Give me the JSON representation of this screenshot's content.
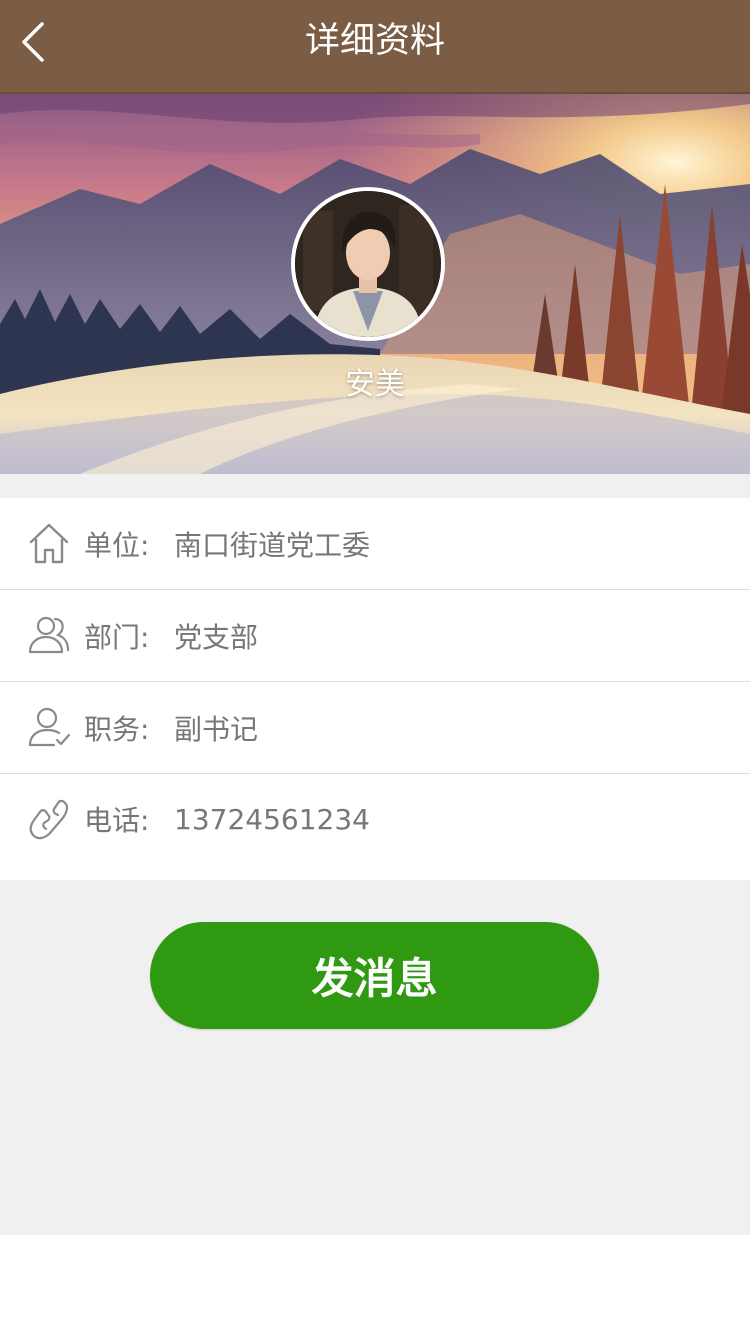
{
  "header": {
    "title": "详细资料",
    "back_icon": "chevron-left-icon"
  },
  "profile": {
    "name": "安美"
  },
  "info": {
    "unit": {
      "icon": "home-icon",
      "label": "单位:",
      "value": "南口街道党工委"
    },
    "department": {
      "icon": "users-icon",
      "label": "部门:",
      "value": "党支部"
    },
    "position": {
      "icon": "user-check-icon",
      "label": "职务:",
      "value": "副书记"
    },
    "phone": {
      "icon": "phone-icon",
      "label": "电话:",
      "value": "13724561234"
    }
  },
  "actions": {
    "send_message_label": "发消息"
  },
  "colors": {
    "header_bg": "#7b5c44",
    "button_bg": "#2f9912",
    "page_bg": "#f0f0f0",
    "text_gray": "#777777"
  }
}
